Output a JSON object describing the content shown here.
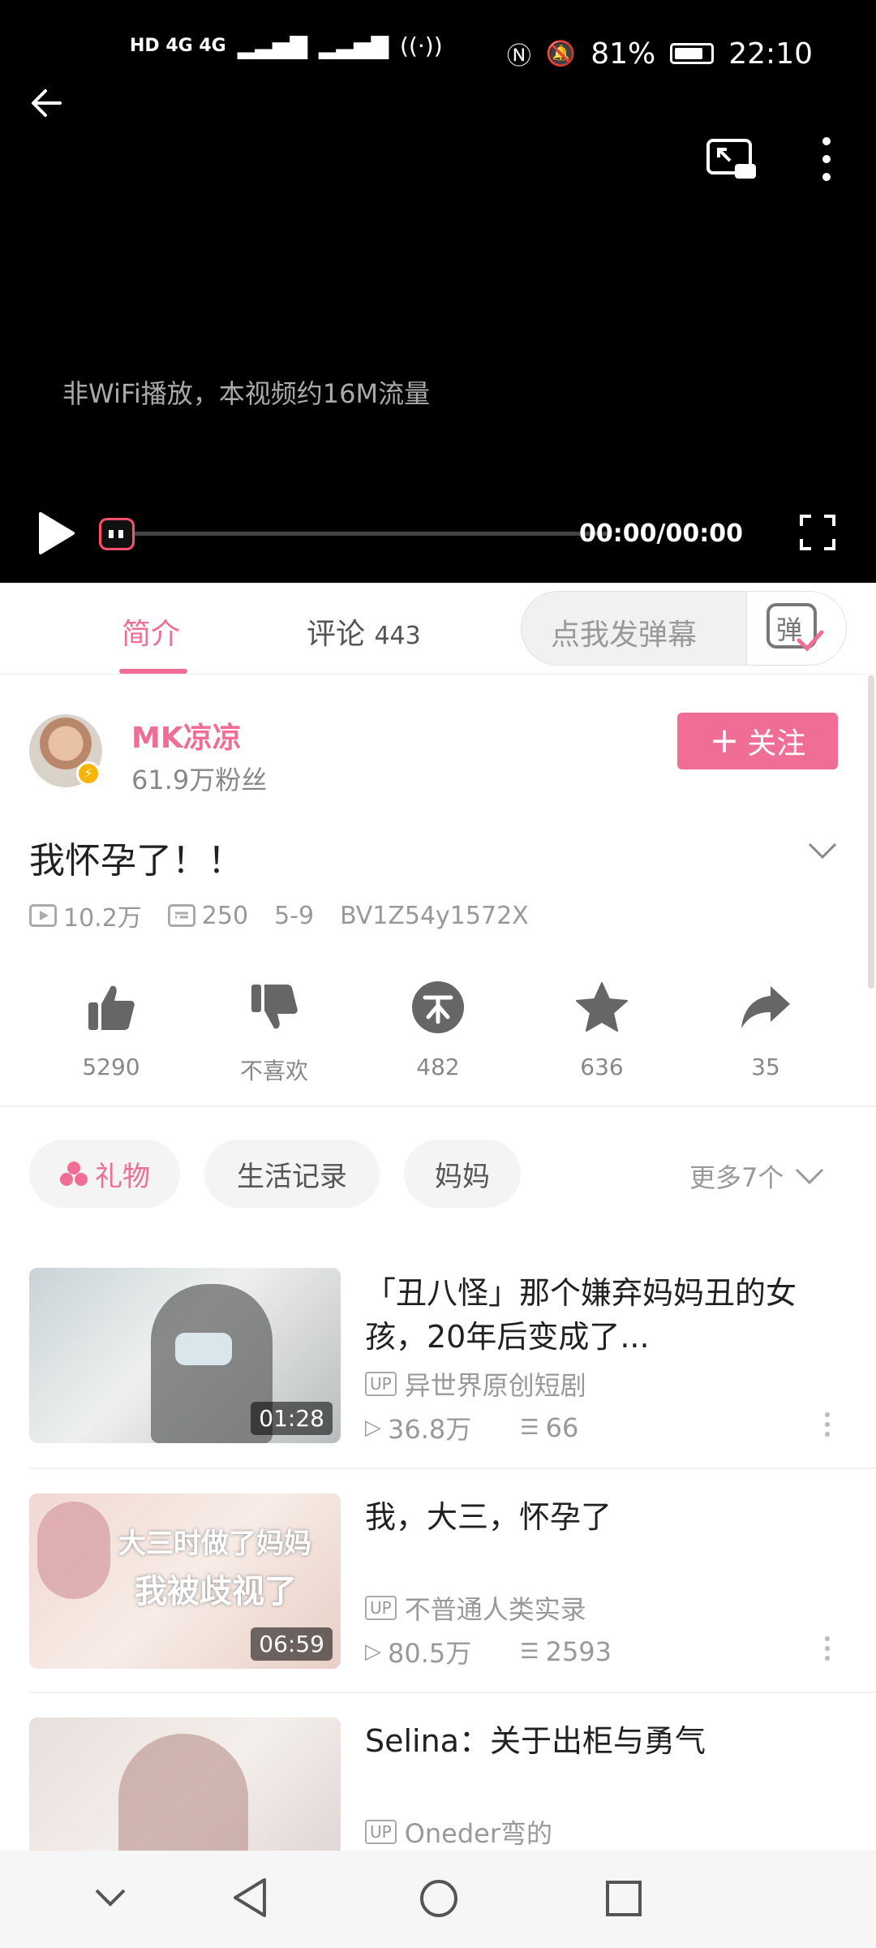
{
  "status_bar": {
    "network": "HD 4G 4G",
    "battery": "81%",
    "battery_level": 0.81,
    "time": "22:10"
  },
  "player": {
    "notice": "非WiFi播放，本视频约16M流量",
    "time": "00:00/00:00",
    "progress": 0
  },
  "tabs": {
    "intro": "简介",
    "comments_label": "评论",
    "comments_count": "443",
    "danmaku_placeholder": "点我发弹幕",
    "danmaku_icon_text": "弹"
  },
  "uploader": {
    "name": "MK凉凉",
    "fans": "61.9万粉丝",
    "follow_label": "关注"
  },
  "video": {
    "title": "我怀孕了！！",
    "views": "10.2万",
    "danmaku_count": "250",
    "date": "5-9",
    "bvid": "BV1Z54y1572X"
  },
  "actions": {
    "like": "5290",
    "dislike": "不喜欢",
    "coin": "482",
    "favorite": "636",
    "share": "35"
  },
  "tags": {
    "items": [
      "礼物",
      "生活记录",
      "妈妈"
    ],
    "more": "更多7个"
  },
  "recommendations": [
    {
      "title": "「丑八怪」那个嫌弃妈妈丑的女孩，20年后变成了...",
      "uploader": "异世界原创短剧",
      "views": "36.8万",
      "comments": "66",
      "duration": "01:28"
    },
    {
      "title": "我，大三，怀孕了",
      "uploader": "不普通人类实录",
      "views": "80.5万",
      "comments": "2593",
      "duration": "06:59",
      "thumb_text_1": "大三时做了妈妈",
      "thumb_text_2": "我被歧视了"
    },
    {
      "title": "Selina：关于出柜与勇气",
      "uploader": "Oneder弯的",
      "views": "",
      "comments": "",
      "duration": ""
    }
  ],
  "colors": {
    "accent": "#f06d96",
    "player_bg": "#000000"
  }
}
